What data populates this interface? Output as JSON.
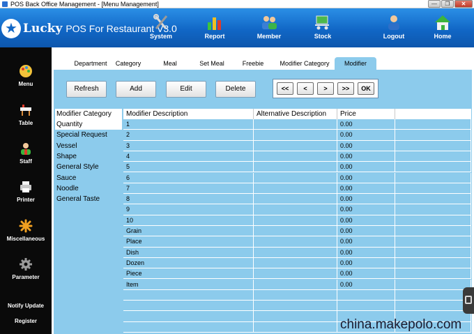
{
  "window": {
    "title": "POS Back Office Management - [Menu Management]"
  },
  "header": {
    "brand": "Lucky",
    "subtitle": "POS For Restaurant V3.0",
    "nav": [
      {
        "label": "System",
        "icon": "tools-icon"
      },
      {
        "label": "Report",
        "icon": "bar-chart-icon"
      },
      {
        "label": "Member",
        "icon": "members-icon"
      },
      {
        "label": "Stock",
        "icon": "cart-icon"
      },
      {
        "label": "Logout",
        "icon": "user-logout-icon"
      },
      {
        "label": "Home",
        "icon": "home-icon"
      }
    ]
  },
  "sidebar": {
    "items": [
      {
        "label": "Menu",
        "icon": "palette-icon"
      },
      {
        "label": "Table",
        "icon": "table-icon"
      },
      {
        "label": "Staff",
        "icon": "staff-icon"
      },
      {
        "label": "Printer",
        "icon": "printer-icon"
      },
      {
        "label": "Miscellaneous",
        "icon": "star-burst-icon"
      },
      {
        "label": "Parameter",
        "icon": "gear-icon"
      },
      {
        "label": "Notify Update",
        "icon": ""
      },
      {
        "label": "Register",
        "icon": ""
      }
    ]
  },
  "tabs": [
    {
      "label": "Department"
    },
    {
      "label": "Category"
    },
    {
      "label": "Meal"
    },
    {
      "label": "Set Meal"
    },
    {
      "label": "Freebie"
    },
    {
      "label": "Modifier Category"
    },
    {
      "label": "Modifier"
    }
  ],
  "active_tab": "Modifier",
  "toolbar": {
    "refresh": "Refresh",
    "add": "Add",
    "edit": "Edit",
    "delete": "Delete",
    "pager": {
      "first": "<<",
      "prev": "<",
      "next": ">",
      "last": ">>",
      "ok": "OK"
    }
  },
  "categories": {
    "header": "Modifier Category",
    "items": [
      "Quantity",
      "Special Request",
      "Vessel",
      "Shape",
      "General Style",
      "Sauce",
      "Noodle",
      "General Taste"
    ],
    "selected": "Quantity"
  },
  "table": {
    "columns": [
      "Modifier Description",
      "Alternative Description",
      "Price"
    ],
    "rows": [
      [
        "1",
        "",
        "0.00"
      ],
      [
        "2",
        "",
        "0.00"
      ],
      [
        "3",
        "",
        "0.00"
      ],
      [
        "4",
        "",
        "0.00"
      ],
      [
        "5",
        "",
        "0.00"
      ],
      [
        "6",
        "",
        "0.00"
      ],
      [
        "7",
        "",
        "0.00"
      ],
      [
        "8",
        "",
        "0.00"
      ],
      [
        "9",
        "",
        "0.00"
      ],
      [
        "10",
        "",
        "0.00"
      ],
      [
        "Grain",
        "",
        "0.00"
      ],
      [
        "Place",
        "",
        "0.00"
      ],
      [
        "Dish",
        "",
        "0.00"
      ],
      [
        "Dozen",
        "",
        "0.00"
      ],
      [
        "Piece",
        "",
        "0.00"
      ],
      [
        "Item",
        "",
        "0.00"
      ]
    ]
  },
  "watermark": "china.makepolo.com",
  "colors": {
    "header_blue": "#1167c6",
    "panel_blue": "#8ccbec",
    "sidebar": "#0a0a0a"
  }
}
